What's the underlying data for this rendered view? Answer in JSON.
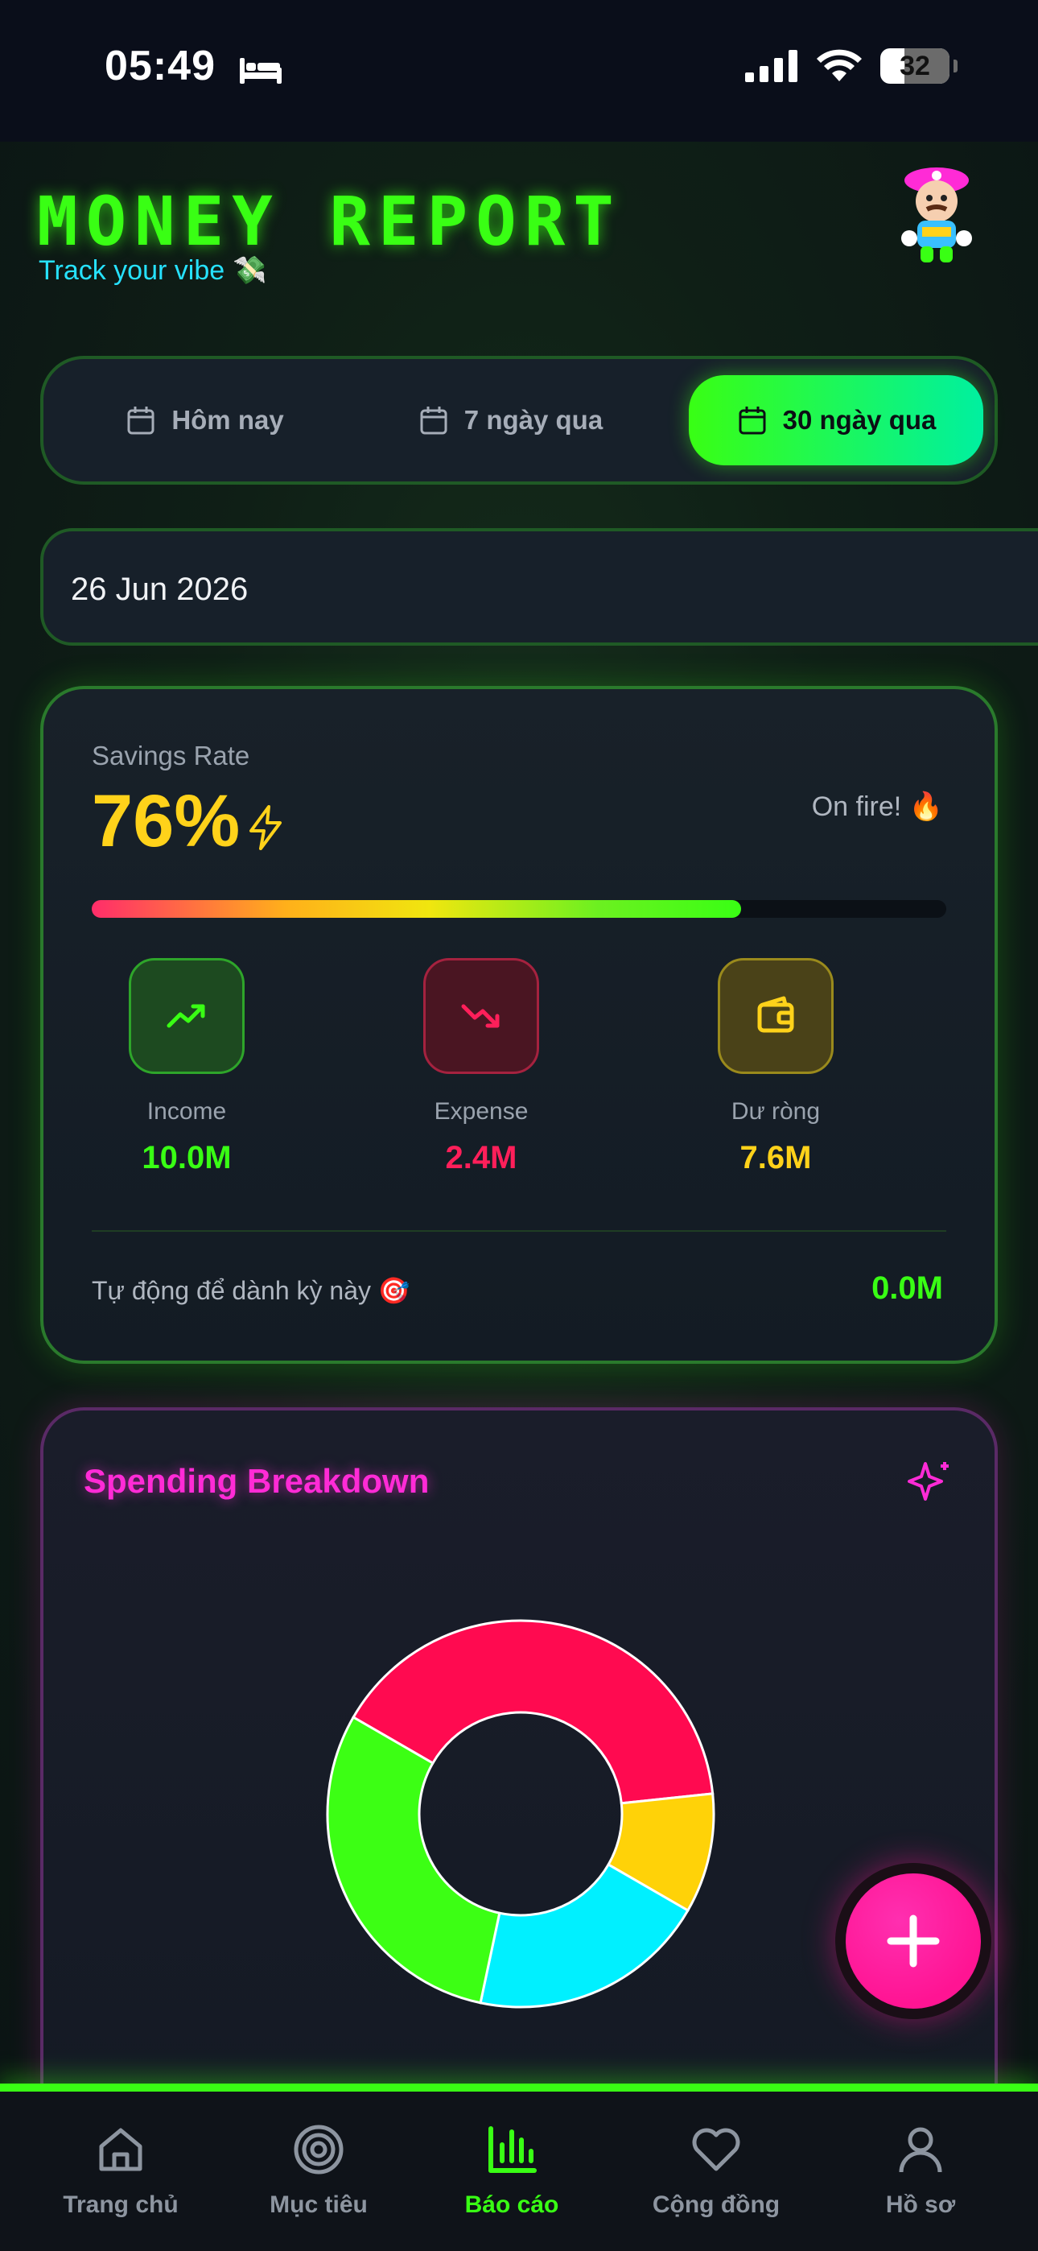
{
  "status_bar": {
    "time": "05:49",
    "battery": "32"
  },
  "header": {
    "title": "MONEY REPORT",
    "subtitle": "Track your vibe",
    "subtitle_emoji": "💸"
  },
  "period_tabs": [
    {
      "label": "Hôm nay",
      "selected": false
    },
    {
      "label": "7 ngày qua",
      "selected": false
    },
    {
      "label": "30 ngày qua",
      "selected": true
    }
  ],
  "date_field": {
    "value": "26 Jun 2026"
  },
  "savings": {
    "label": "Savings Rate",
    "value": "76%",
    "status": "On fire! 🔥",
    "progress": 0.76,
    "stats": [
      {
        "label": "Income",
        "value": "10.0M",
        "icon": "trending-up-icon"
      },
      {
        "label": "Expense",
        "value": "2.4M",
        "icon": "trending-down-icon"
      },
      {
        "label": "Dư ròng",
        "value": "7.6M",
        "icon": "wallet-icon"
      }
    ],
    "auto_save_label": "Tự động để dành kỳ này 🎯",
    "auto_save_value": "0.0M"
  },
  "spending": {
    "title": "Spending Breakdown",
    "segments": [
      {
        "color": "#ff0a50",
        "fraction": 0.4
      },
      {
        "color": "#ffd208",
        "fraction": 0.1
      },
      {
        "color": "#00f0ff",
        "fraction": 0.2
      },
      {
        "color": "#3cff14",
        "fraction": 0.3
      }
    ]
  },
  "colors": {
    "accent": "#39ff14",
    "pink": "#ff2bd6",
    "fab": "#ff1493"
  },
  "nav": [
    {
      "label": "Trang chủ",
      "icon": "home-icon",
      "active": false
    },
    {
      "label": "Mục tiêu",
      "icon": "target-icon",
      "active": false
    },
    {
      "label": "Báo cáo",
      "icon": "bar-chart-icon",
      "active": true
    },
    {
      "label": "Cộng đồng",
      "icon": "heart-icon",
      "active": false
    },
    {
      "label": "Hồ sơ",
      "icon": "user-icon",
      "active": false
    }
  ]
}
